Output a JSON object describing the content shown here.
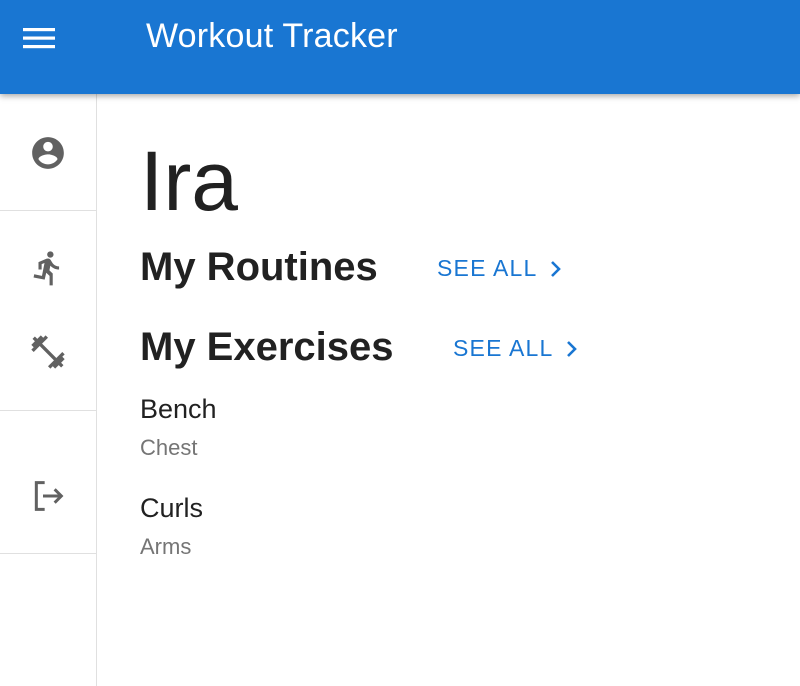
{
  "appbar": {
    "title": "Workout Tracker",
    "menu_icon": "menu-icon",
    "color": "#1976d2"
  },
  "sidebar": {
    "items": [
      {
        "icon": "account-circle-icon"
      },
      {
        "icon": "running-icon"
      },
      {
        "icon": "fitness-dumbbell-icon"
      },
      {
        "icon": "logout-icon"
      }
    ]
  },
  "main": {
    "user_name": "Ira",
    "routines": {
      "title": "My Routines",
      "see_all_label": "SEE ALL"
    },
    "exercises": {
      "title": "My Exercises",
      "see_all_label": "SEE ALL",
      "items": [
        {
          "name": "Bench",
          "muscle_group": "Chest"
        },
        {
          "name": "Curls",
          "muscle_group": "Arms"
        }
      ]
    }
  },
  "colors": {
    "accent": "#1976d2",
    "secondary_text": "#757575",
    "icon": "#616161"
  }
}
